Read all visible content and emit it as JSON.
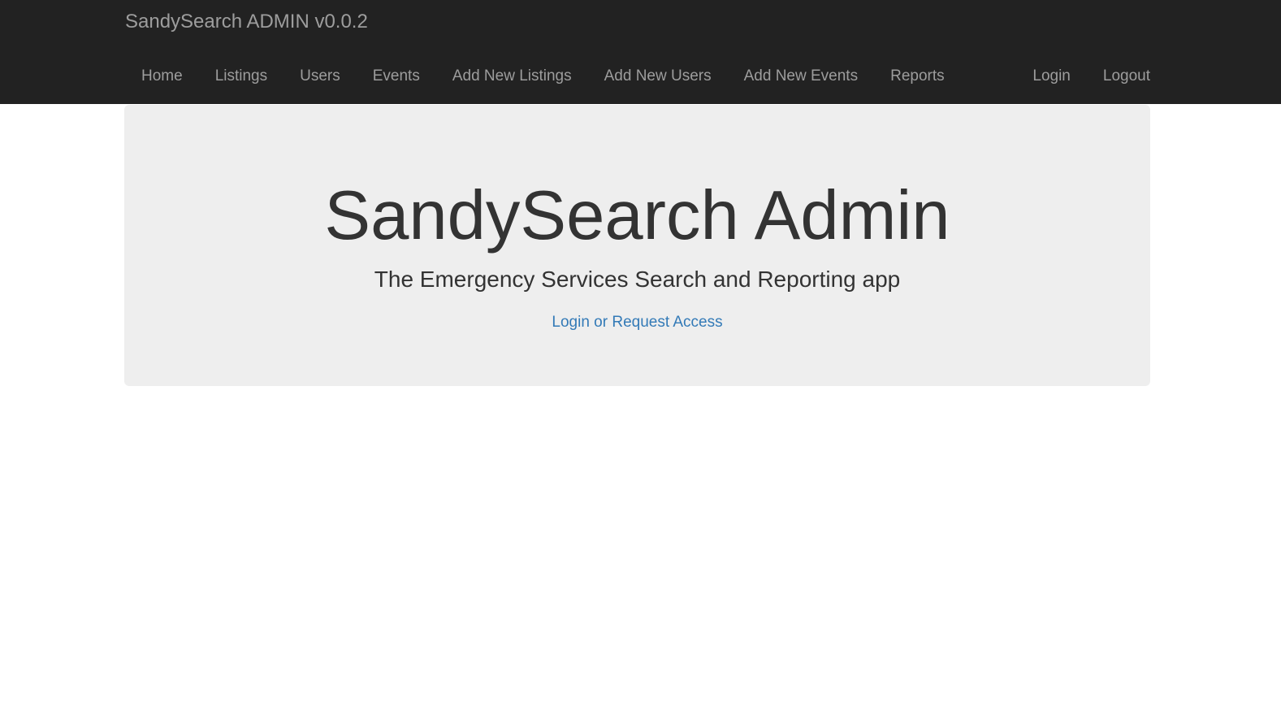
{
  "navbar": {
    "brand": "SandySearch ADMIN v0.0.2",
    "left_items": [
      {
        "label": "Home"
      },
      {
        "label": "Listings"
      },
      {
        "label": "Users"
      },
      {
        "label": "Events"
      },
      {
        "label": "Add New Listings"
      },
      {
        "label": "Add New Users"
      },
      {
        "label": "Add New Events"
      },
      {
        "label": "Reports"
      }
    ],
    "right_items": [
      {
        "label": "Login"
      },
      {
        "label": "Logout"
      }
    ]
  },
  "hero": {
    "title": "SandySearch Admin",
    "subtitle": "The Emergency Services Search and Reporting app",
    "link_label": "Login or Request Access"
  },
  "colors": {
    "navbar_bg": "#222222",
    "nav_text": "#9d9d9d",
    "jumbotron_bg": "#eeeeee",
    "heading_text": "#333333",
    "link": "#337ab7"
  }
}
